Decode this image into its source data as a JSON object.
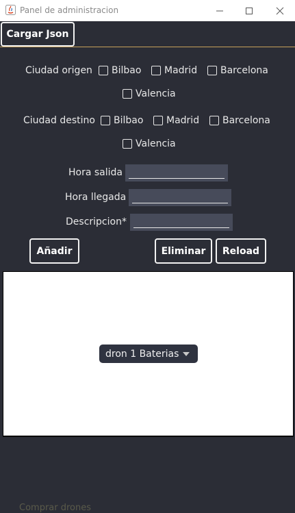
{
  "window": {
    "title": "Panel de administracion"
  },
  "menubar": {
    "load_json": "Cargar Json"
  },
  "origin": {
    "label": "Ciudad origen",
    "options": [
      "Bilbao",
      "Madrid",
      "Barcelona",
      "Valencia"
    ]
  },
  "destination": {
    "label": "Ciudad destino",
    "options": [
      "Bilbao",
      "Madrid",
      "Barcelona",
      "Valencia"
    ]
  },
  "form": {
    "departure_label": "Hora salida",
    "arrival_label": "Hora llegada",
    "description_label": "Descripcion*",
    "departure_value": "",
    "arrival_value": "",
    "description_value": ""
  },
  "actions": {
    "add": "Añadir",
    "delete": "Eliminar",
    "reload": "Reload"
  },
  "combo": {
    "selected": "dron 1 Baterias"
  },
  "footer": {
    "text": "Comprar drones"
  },
  "colors": {
    "background": "#2b2d36",
    "field": "#474b5a",
    "menubar_border": "#c9a25a"
  }
}
